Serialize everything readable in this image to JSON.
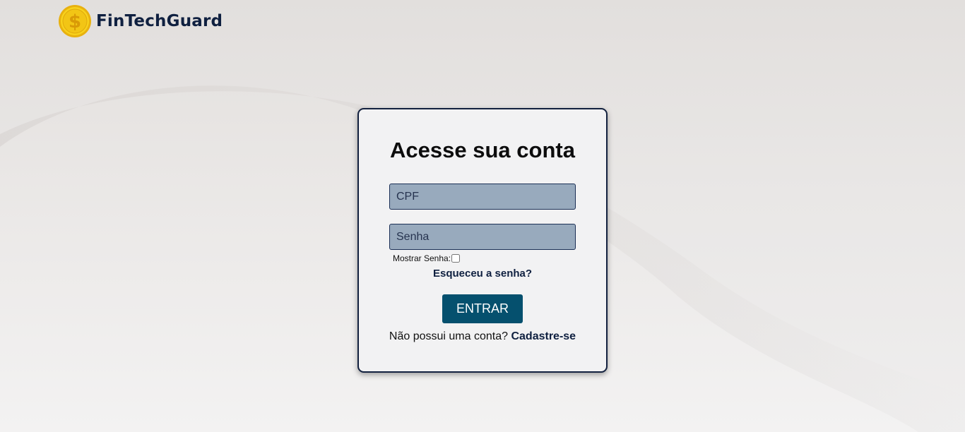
{
  "brand": {
    "name": "FinTechGuard",
    "logo_icon": "dollar-coin-icon",
    "logo_symbol": "$"
  },
  "login": {
    "title": "Acesse sua conta",
    "cpf_placeholder": "CPF",
    "password_placeholder": "Senha",
    "show_password_label": "Mostrar Senha:",
    "show_password_checked": false,
    "forgot_password": "Esqueceu a senha?",
    "submit_label": "ENTRAR",
    "no_account_text": "Não possui uma conta?",
    "signup_link": "Cadastre-se"
  },
  "colors": {
    "brand_text": "#0f2040",
    "card_border": "#13213f",
    "input_bg": "#98aabd",
    "button_bg": "#05506e",
    "coin": "#f5c518"
  }
}
